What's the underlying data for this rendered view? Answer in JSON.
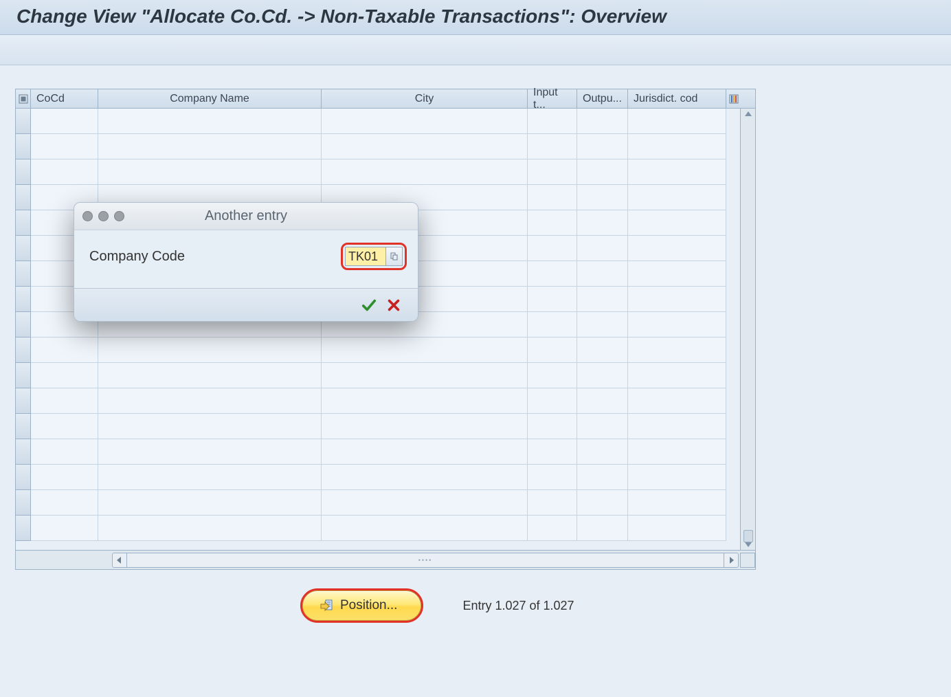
{
  "title": "Change View \"Allocate Co.Cd. -> Non-Taxable Transactions\": Overview",
  "columns": {
    "cocd": "CoCd",
    "company": "Company Name",
    "city": "City",
    "input": "Input t...",
    "output": "Outpu...",
    "juris": "Jurisdict. cod"
  },
  "dialog": {
    "title": "Another entry",
    "field_label": "Company Code",
    "value": "TK01"
  },
  "footer": {
    "position_label": "Position...",
    "entry_status": "Entry 1.027 of 1.027"
  },
  "icons": {
    "select_all": "select-all-icon",
    "table_config": "table-config-icon",
    "checkmark": "checkmark-icon",
    "cancel": "cancel-icon",
    "search_help": "search-help-icon",
    "position": "position-icon",
    "scroll_up": "scroll-up-icon",
    "scroll_down": "scroll-down-icon",
    "scroll_left": "scroll-left-icon",
    "scroll_right": "scroll-right-icon"
  }
}
